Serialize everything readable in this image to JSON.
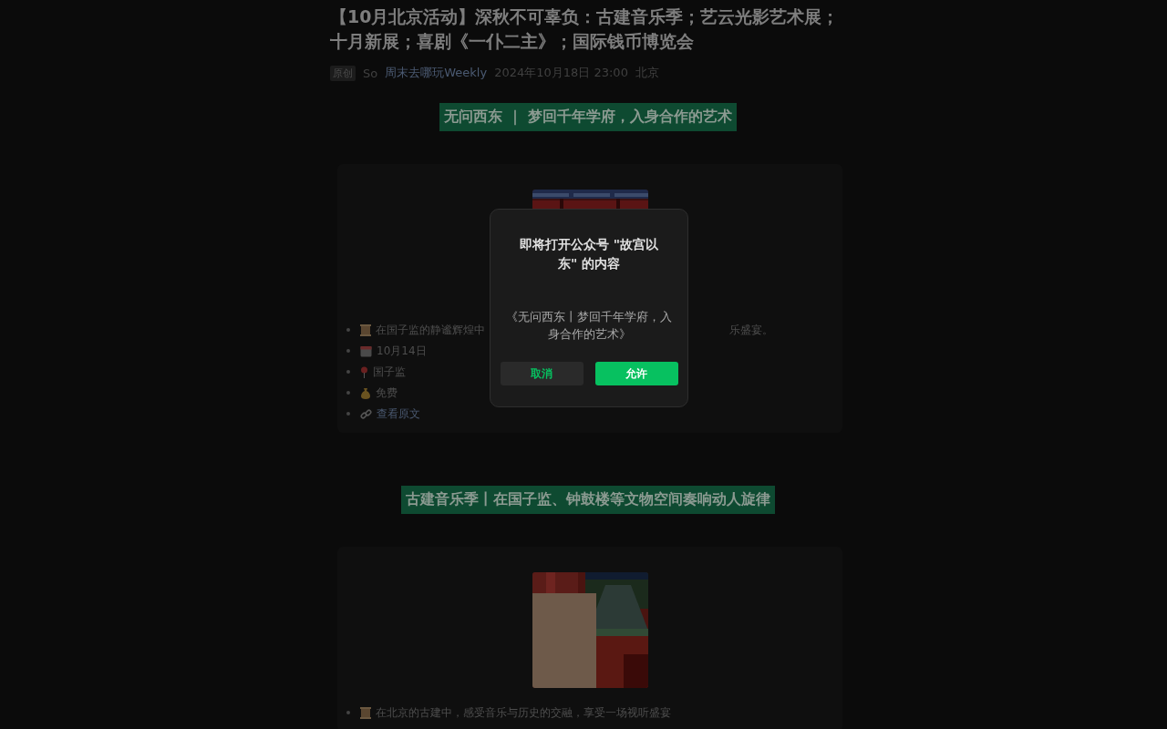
{
  "article": {
    "title": "【10月北京活动】深秋不可辜负：古建音乐季；艺云光影艺术展；十月新展；喜剧《一仆二主》；国际钱币博览会",
    "meta": {
      "badge": "原创",
      "author": "So",
      "account": "周末去哪玩Weekly",
      "datetime": "2024年10月18日 23:00",
      "location": "北京"
    },
    "sections": [
      {
        "heading": "无问西东 ｜ 梦回千年学府，入身合作的艺术",
        "image": {
          "kind": "picture"
        },
        "items": [
          {
            "kind": "intro",
            "segments": [
              "在国子监的静谧辉煌中",
              "乐盛宴。"
            ]
          },
          {
            "kind": "date",
            "segments": [
              "10月14日"
            ]
          },
          {
            "kind": "place",
            "segments": [
              "国子监"
            ]
          },
          {
            "kind": "price",
            "segments": [
              "免费"
            ]
          },
          {
            "kind": "link",
            "segments": [
              "查看原文"
            ]
          }
        ]
      },
      {
        "heading": "古建音乐季丨在国子监、钟鼓楼等文物空间奏响动人旋律",
        "image": {
          "kind": "picture"
        },
        "items": [
          {
            "kind": "intro",
            "segments": [
              "在北京的古建中，感受音乐与历史的交融，享受一场视听盛宴"
            ]
          }
        ]
      }
    ]
  },
  "dialog": {
    "title": "即将打开公众号 \"故宫以东\" 的内容",
    "message": "《无问西东丨梦回千年学府，入身合作的艺术》",
    "buttons": [
      {
        "label": "取消",
        "kind": "secondary"
      },
      {
        "label": "允许",
        "kind": "primary"
      }
    ]
  }
}
